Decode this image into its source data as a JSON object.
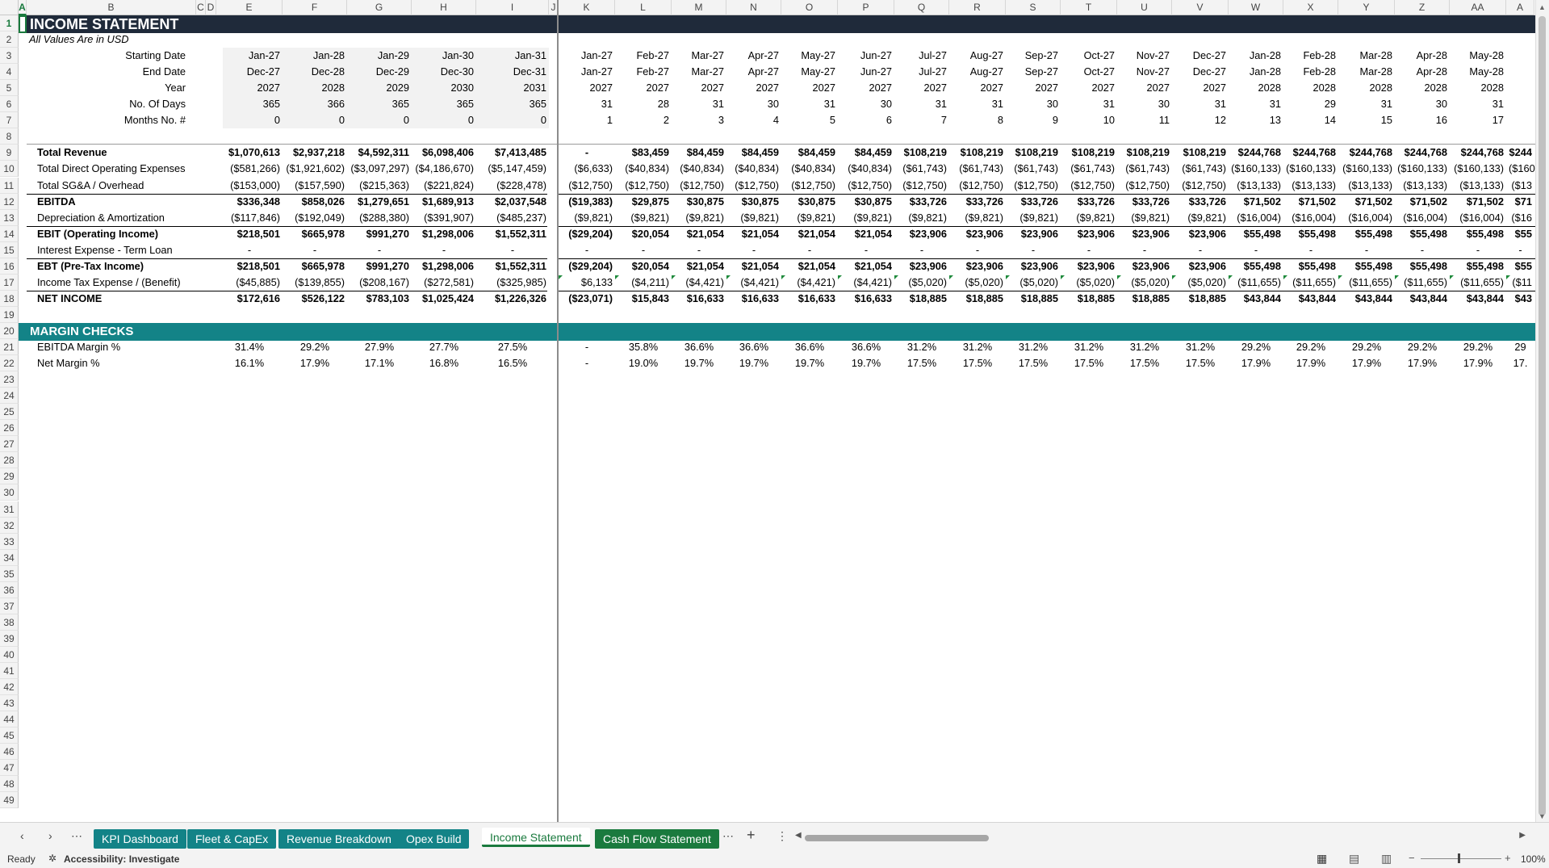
{
  "colors": {
    "header_band": "#1f2a3a",
    "margin_band": "#138387",
    "tab_teal": "#138387",
    "tab_green": "#1a7a3e",
    "input_fill": "#f2f2f2"
  },
  "columns": [
    "A",
    "B",
    "C",
    "D",
    "E",
    "F",
    "G",
    "H",
    "I",
    "J",
    "K",
    "L",
    "M",
    "N",
    "O",
    "P",
    "Q",
    "R",
    "S",
    "T",
    "U",
    "V",
    "W",
    "X",
    "Y",
    "Z",
    "AA",
    "A"
  ],
  "rows": [
    "1",
    "2",
    "3",
    "4",
    "5",
    "6",
    "7",
    "8",
    "9",
    "10",
    "11",
    "12",
    "13",
    "14",
    "15",
    "16",
    "17",
    "18",
    "19",
    "20",
    "21",
    "22",
    "23",
    "24",
    "25",
    "26",
    "27",
    "28",
    "29",
    "30",
    "31",
    "32",
    "33",
    "34",
    "35",
    "36",
    "37",
    "38",
    "39",
    "40",
    "41",
    "42",
    "43",
    "44",
    "45",
    "46",
    "47",
    "48",
    "49"
  ],
  "sheet": {
    "title": "INCOME STATEMENT",
    "subtitle": "All Values Are in USD",
    "margin_title": "MARGIN CHECKS",
    "header_rows": [
      {
        "label": "Starting Date",
        "annual": [
          "Jan-27",
          "Jan-28",
          "Jan-29",
          "Jan-30",
          "Jan-31"
        ],
        "monthly": [
          "Jan-27",
          "Feb-27",
          "Mar-27",
          "Apr-27",
          "May-27",
          "Jun-27",
          "Jul-27",
          "Aug-27",
          "Sep-27",
          "Oct-27",
          "Nov-27",
          "Dec-27",
          "Jan-28",
          "Feb-28",
          "Mar-28",
          "Apr-28",
          "May-28"
        ]
      },
      {
        "label": "End Date",
        "annual": [
          "Dec-27",
          "Dec-28",
          "Dec-29",
          "Dec-30",
          "Dec-31"
        ],
        "monthly": [
          "Jan-27",
          "Feb-27",
          "Mar-27",
          "Apr-27",
          "May-27",
          "Jun-27",
          "Jul-27",
          "Aug-27",
          "Sep-27",
          "Oct-27",
          "Nov-27",
          "Dec-27",
          "Jan-28",
          "Feb-28",
          "Mar-28",
          "Apr-28",
          "May-28"
        ]
      },
      {
        "label": "Year",
        "annual": [
          "2027",
          "2028",
          "2029",
          "2030",
          "2031"
        ],
        "monthly": [
          "2027",
          "2027",
          "2027",
          "2027",
          "2027",
          "2027",
          "2027",
          "2027",
          "2027",
          "2027",
          "2027",
          "2027",
          "2028",
          "2028",
          "2028",
          "2028",
          "2028"
        ]
      },
      {
        "label": "No. Of Days",
        "annual": [
          "365",
          "366",
          "365",
          "365",
          "365"
        ],
        "monthly": [
          "31",
          "28",
          "31",
          "30",
          "31",
          "30",
          "31",
          "31",
          "30",
          "31",
          "30",
          "31",
          "31",
          "29",
          "31",
          "30",
          "31"
        ]
      },
      {
        "label": "Months No. #",
        "annual": [
          "0",
          "0",
          "0",
          "0",
          "0"
        ],
        "monthly": [
          "1",
          "2",
          "3",
          "4",
          "5",
          "6",
          "7",
          "8",
          "9",
          "10",
          "11",
          "12",
          "13",
          "14",
          "15",
          "16",
          "17"
        ]
      }
    ],
    "income_rows": [
      {
        "label": "Total Revenue",
        "bold": true,
        "annual": [
          "$1,070,613",
          "$2,937,218",
          "$4,592,311",
          "$6,098,406",
          "$7,413,485"
        ],
        "monthly": [
          "-",
          "$83,459",
          "$84,459",
          "$84,459",
          "$84,459",
          "$84,459",
          "$108,219",
          "$108,219",
          "$108,219",
          "$108,219",
          "$108,219",
          "$108,219",
          "$244,768",
          "$244,768",
          "$244,768",
          "$244,768",
          "$244,768",
          "$244"
        ]
      },
      {
        "label": "Total Direct Operating Expenses",
        "bold": false,
        "annual": [
          "($581,266)",
          "($1,921,602)",
          "($3,097,297)",
          "($4,186,670)",
          "($5,147,459)"
        ],
        "monthly": [
          "($6,633)",
          "($40,834)",
          "($40,834)",
          "($40,834)",
          "($40,834)",
          "($40,834)",
          "($61,743)",
          "($61,743)",
          "($61,743)",
          "($61,743)",
          "($61,743)",
          "($61,743)",
          "($160,133)",
          "($160,133)",
          "($160,133)",
          "($160,133)",
          "($160,133)",
          "($160"
        ]
      },
      {
        "label": "Total SG&A / Overhead",
        "bold": false,
        "annual": [
          "($153,000)",
          "($157,590)",
          "($215,363)",
          "($221,824)",
          "($228,478)"
        ],
        "monthly": [
          "($12,750)",
          "($12,750)",
          "($12,750)",
          "($12,750)",
          "($12,750)",
          "($12,750)",
          "($12,750)",
          "($12,750)",
          "($12,750)",
          "($12,750)",
          "($12,750)",
          "($12,750)",
          "($13,133)",
          "($13,133)",
          "($13,133)",
          "($13,133)",
          "($13,133)",
          "($13"
        ]
      },
      {
        "label": "EBITDA",
        "bold": true,
        "annual": [
          "$336,348",
          "$858,026",
          "$1,279,651",
          "$1,689,913",
          "$2,037,548"
        ],
        "monthly": [
          "($19,383)",
          "$29,875",
          "$30,875",
          "$30,875",
          "$30,875",
          "$30,875",
          "$33,726",
          "$33,726",
          "$33,726",
          "$33,726",
          "$33,726",
          "$33,726",
          "$71,502",
          "$71,502",
          "$71,502",
          "$71,502",
          "$71,502",
          "$71"
        ]
      },
      {
        "label": "Depreciation & Amortization",
        "bold": false,
        "annual": [
          "($117,846)",
          "($192,049)",
          "($288,380)",
          "($391,907)",
          "($485,237)"
        ],
        "monthly": [
          "($9,821)",
          "($9,821)",
          "($9,821)",
          "($9,821)",
          "($9,821)",
          "($9,821)",
          "($9,821)",
          "($9,821)",
          "($9,821)",
          "($9,821)",
          "($9,821)",
          "($9,821)",
          "($16,004)",
          "($16,004)",
          "($16,004)",
          "($16,004)",
          "($16,004)",
          "($16"
        ]
      },
      {
        "label": "EBIT (Operating Income)",
        "bold": true,
        "annual": [
          "$218,501",
          "$665,978",
          "$991,270",
          "$1,298,006",
          "$1,552,311"
        ],
        "monthly": [
          "($29,204)",
          "$20,054",
          "$21,054",
          "$21,054",
          "$21,054",
          "$21,054",
          "$23,906",
          "$23,906",
          "$23,906",
          "$23,906",
          "$23,906",
          "$23,906",
          "$55,498",
          "$55,498",
          "$55,498",
          "$55,498",
          "$55,498",
          "$55"
        ]
      },
      {
        "label": "Interest Expense - Term Loan",
        "bold": false,
        "annual": [
          "-",
          "-",
          "-",
          "-",
          "-"
        ],
        "monthly": [
          "-",
          "-",
          "-",
          "-",
          "-",
          "-",
          "-",
          "-",
          "-",
          "-",
          "-",
          "-",
          "-",
          "-",
          "-",
          "-",
          "-",
          "-"
        ]
      },
      {
        "label": "EBT (Pre-Tax Income)",
        "bold": true,
        "annual": [
          "$218,501",
          "$665,978",
          "$991,270",
          "$1,298,006",
          "$1,552,311"
        ],
        "monthly": [
          "($29,204)",
          "$20,054",
          "$21,054",
          "$21,054",
          "$21,054",
          "$21,054",
          "$23,906",
          "$23,906",
          "$23,906",
          "$23,906",
          "$23,906",
          "$23,906",
          "$55,498",
          "$55,498",
          "$55,498",
          "$55,498",
          "$55,498",
          "$55"
        ]
      },
      {
        "label": "Income Tax Expense / (Benefit)",
        "bold": false,
        "annual": [
          "($45,885)",
          "($139,855)",
          "($208,167)",
          "($272,581)",
          "($325,985)"
        ],
        "monthly": [
          "$6,133",
          "($4,211)",
          "($4,421)",
          "($4,421)",
          "($4,421)",
          "($4,421)",
          "($5,020)",
          "($5,020)",
          "($5,020)",
          "($5,020)",
          "($5,020)",
          "($5,020)",
          "($11,655)",
          "($11,655)",
          "($11,655)",
          "($11,655)",
          "($11,655)",
          "($11"
        ]
      },
      {
        "label": "NET INCOME",
        "bold": true,
        "annual": [
          "$172,616",
          "$526,122",
          "$783,103",
          "$1,025,424",
          "$1,226,326"
        ],
        "monthly": [
          "($23,071)",
          "$15,843",
          "$16,633",
          "$16,633",
          "$16,633",
          "$16,633",
          "$18,885",
          "$18,885",
          "$18,885",
          "$18,885",
          "$18,885",
          "$18,885",
          "$43,844",
          "$43,844",
          "$43,844",
          "$43,844",
          "$43,844",
          "$43"
        ]
      }
    ],
    "margin_rows": [
      {
        "label": "EBITDA Margin %",
        "annual": [
          "31.4%",
          "29.2%",
          "27.9%",
          "27.7%",
          "27.5%"
        ],
        "monthly": [
          "-",
          "35.8%",
          "36.6%",
          "36.6%",
          "36.6%",
          "36.6%",
          "31.2%",
          "31.2%",
          "31.2%",
          "31.2%",
          "31.2%",
          "31.2%",
          "29.2%",
          "29.2%",
          "29.2%",
          "29.2%",
          "29.2%",
          "29"
        ]
      },
      {
        "label": "Net Margin %",
        "annual": [
          "16.1%",
          "17.9%",
          "17.1%",
          "16.8%",
          "16.5%"
        ],
        "monthly": [
          "-",
          "19.0%",
          "19.7%",
          "19.7%",
          "19.7%",
          "19.7%",
          "17.5%",
          "17.5%",
          "17.5%",
          "17.5%",
          "17.5%",
          "17.5%",
          "17.9%",
          "17.9%",
          "17.9%",
          "17.9%",
          "17.9%",
          "17."
        ]
      }
    ]
  },
  "tabs": {
    "tab_more_left": "⋯",
    "items": [
      {
        "label": "KPI Dashboard",
        "style": "teal"
      },
      {
        "label": "Fleet & CapEx",
        "style": "teal"
      },
      {
        "label": "Revenue Breakdown",
        "style": "teal"
      },
      {
        "label": "Opex Build",
        "style": "teal"
      },
      {
        "label": "Income Statement",
        "style": "active"
      },
      {
        "label": "Cash Flow Statement",
        "style": "green"
      }
    ],
    "tab_more_right": "⋯",
    "add_label": "+",
    "options_label": "⋮"
  },
  "status": {
    "ready": "Ready",
    "accessibility": "Accessibility: Investigate",
    "zoom": "100%"
  }
}
